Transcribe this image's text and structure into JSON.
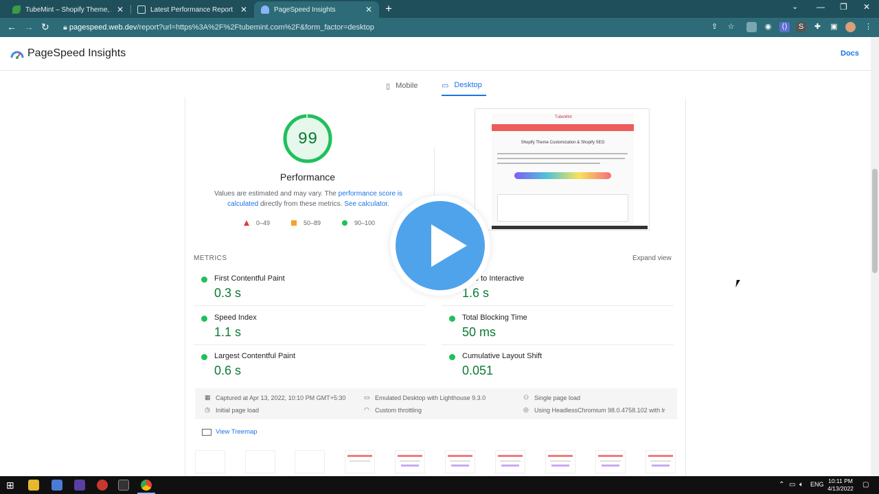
{
  "browser": {
    "tabs": [
      {
        "title": "TubeMint – Shopify Theme, App Exp",
        "active": false
      },
      {
        "title": "Latest Performance Report for: http",
        "active": false
      },
      {
        "title": "PageSpeed Insights",
        "active": true
      }
    ],
    "url_host": "pagespeed.web.dev",
    "url_path": "/report?url=https%3A%2F%2Ftubemint.com%2F&form_factor=desktop",
    "extension_letter": "S"
  },
  "header": {
    "app_title": "PageSpeed Insights",
    "docs_link": "Docs"
  },
  "device_tabs": [
    {
      "label": "Mobile",
      "active": false
    },
    {
      "label": "Desktop",
      "active": true
    }
  ],
  "performance": {
    "score": "99",
    "score_fraction": 0.99,
    "title": "Performance",
    "desc_prefix": "Values are estimated and may vary. The ",
    "desc_link1": "performance score is calculated",
    "desc_mid": " directly from these metrics. ",
    "desc_link2": "See calculator",
    "desc_suffix": ".",
    "legend": [
      {
        "range": "0–49",
        "color": "#e13939"
      },
      {
        "range": "50–89",
        "color": "#f4a42a"
      },
      {
        "range": "90–100",
        "color": "#1fc05b"
      }
    ]
  },
  "screenshot_preview": {
    "logo": "TubeMint",
    "heading": "Shopify Theme Customization & Shopify SEO"
  },
  "metrics": {
    "label": "METRICS",
    "expand_label": "Expand view",
    "items": [
      {
        "name": "First Contentful Paint",
        "value": "0.3 s"
      },
      {
        "name": "Time to Interactive",
        "value": "1.6 s"
      },
      {
        "name": "Speed Index",
        "value": "1.1 s"
      },
      {
        "name": "Total Blocking Time",
        "value": "50 ms"
      },
      {
        "name": "Largest Contentful Paint",
        "value": "0.6 s"
      },
      {
        "name": "Cumulative Layout Shift",
        "value": "0.051"
      }
    ]
  },
  "run_info": {
    "captured": "Captured at Apr 13, 2022, 10:10 PM GMT+5:30",
    "emulated": "Emulated Desktop with Lighthouse 9.3.0",
    "single_page": "Single page load",
    "initial_load": "Initial page load",
    "throttling": "Custom throttling",
    "browser": "Using HeadlessChromium 98.0.4758.102 with lr"
  },
  "treemap_label": "View Treemap",
  "taskbar": {
    "lang": "ENG",
    "time": "10:11 PM",
    "date": "4/13/2022"
  },
  "colors": {
    "accent": "#1a73e8",
    "pass": "#0b7a35",
    "chrome_bg": "#2d6b78"
  }
}
